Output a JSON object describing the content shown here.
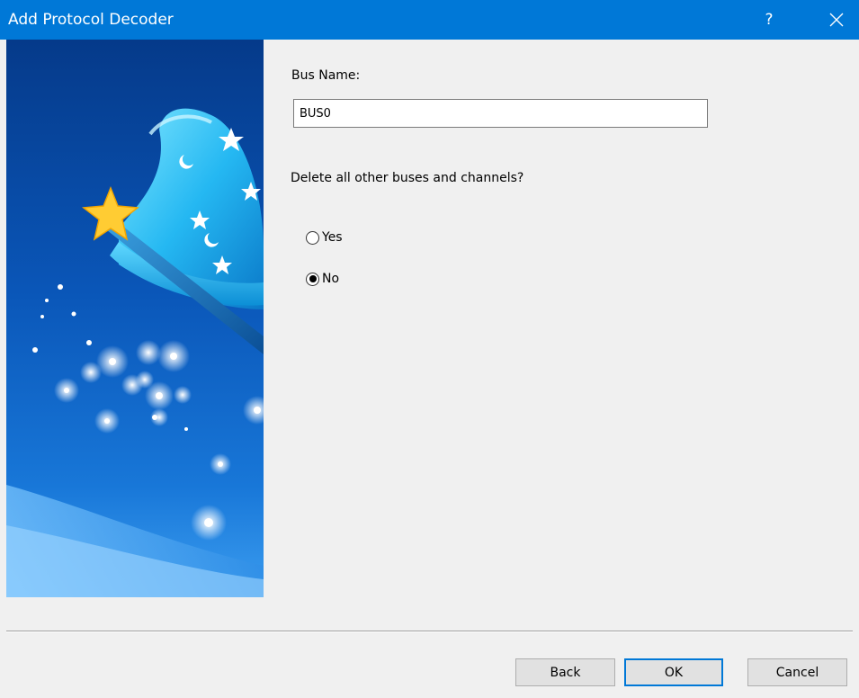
{
  "window": {
    "title": "Add Protocol Decoder",
    "help_glyph": "?",
    "close_icon": "close-icon"
  },
  "wizard_image": {
    "icon": "wizard-hat-magic-wand-icon"
  },
  "form": {
    "bus_name_label": "Bus Name:",
    "bus_name_value": "BUS0",
    "delete_question": "Delete all other buses and channels?",
    "options": [
      {
        "label": "Yes",
        "selected": false
      },
      {
        "label": "No",
        "selected": true
      }
    ]
  },
  "buttons": {
    "back": "Back",
    "ok": "OK",
    "cancel": "Cancel"
  },
  "colors": {
    "titlebar": "#0078d7",
    "default_button_border": "#0078d7"
  }
}
